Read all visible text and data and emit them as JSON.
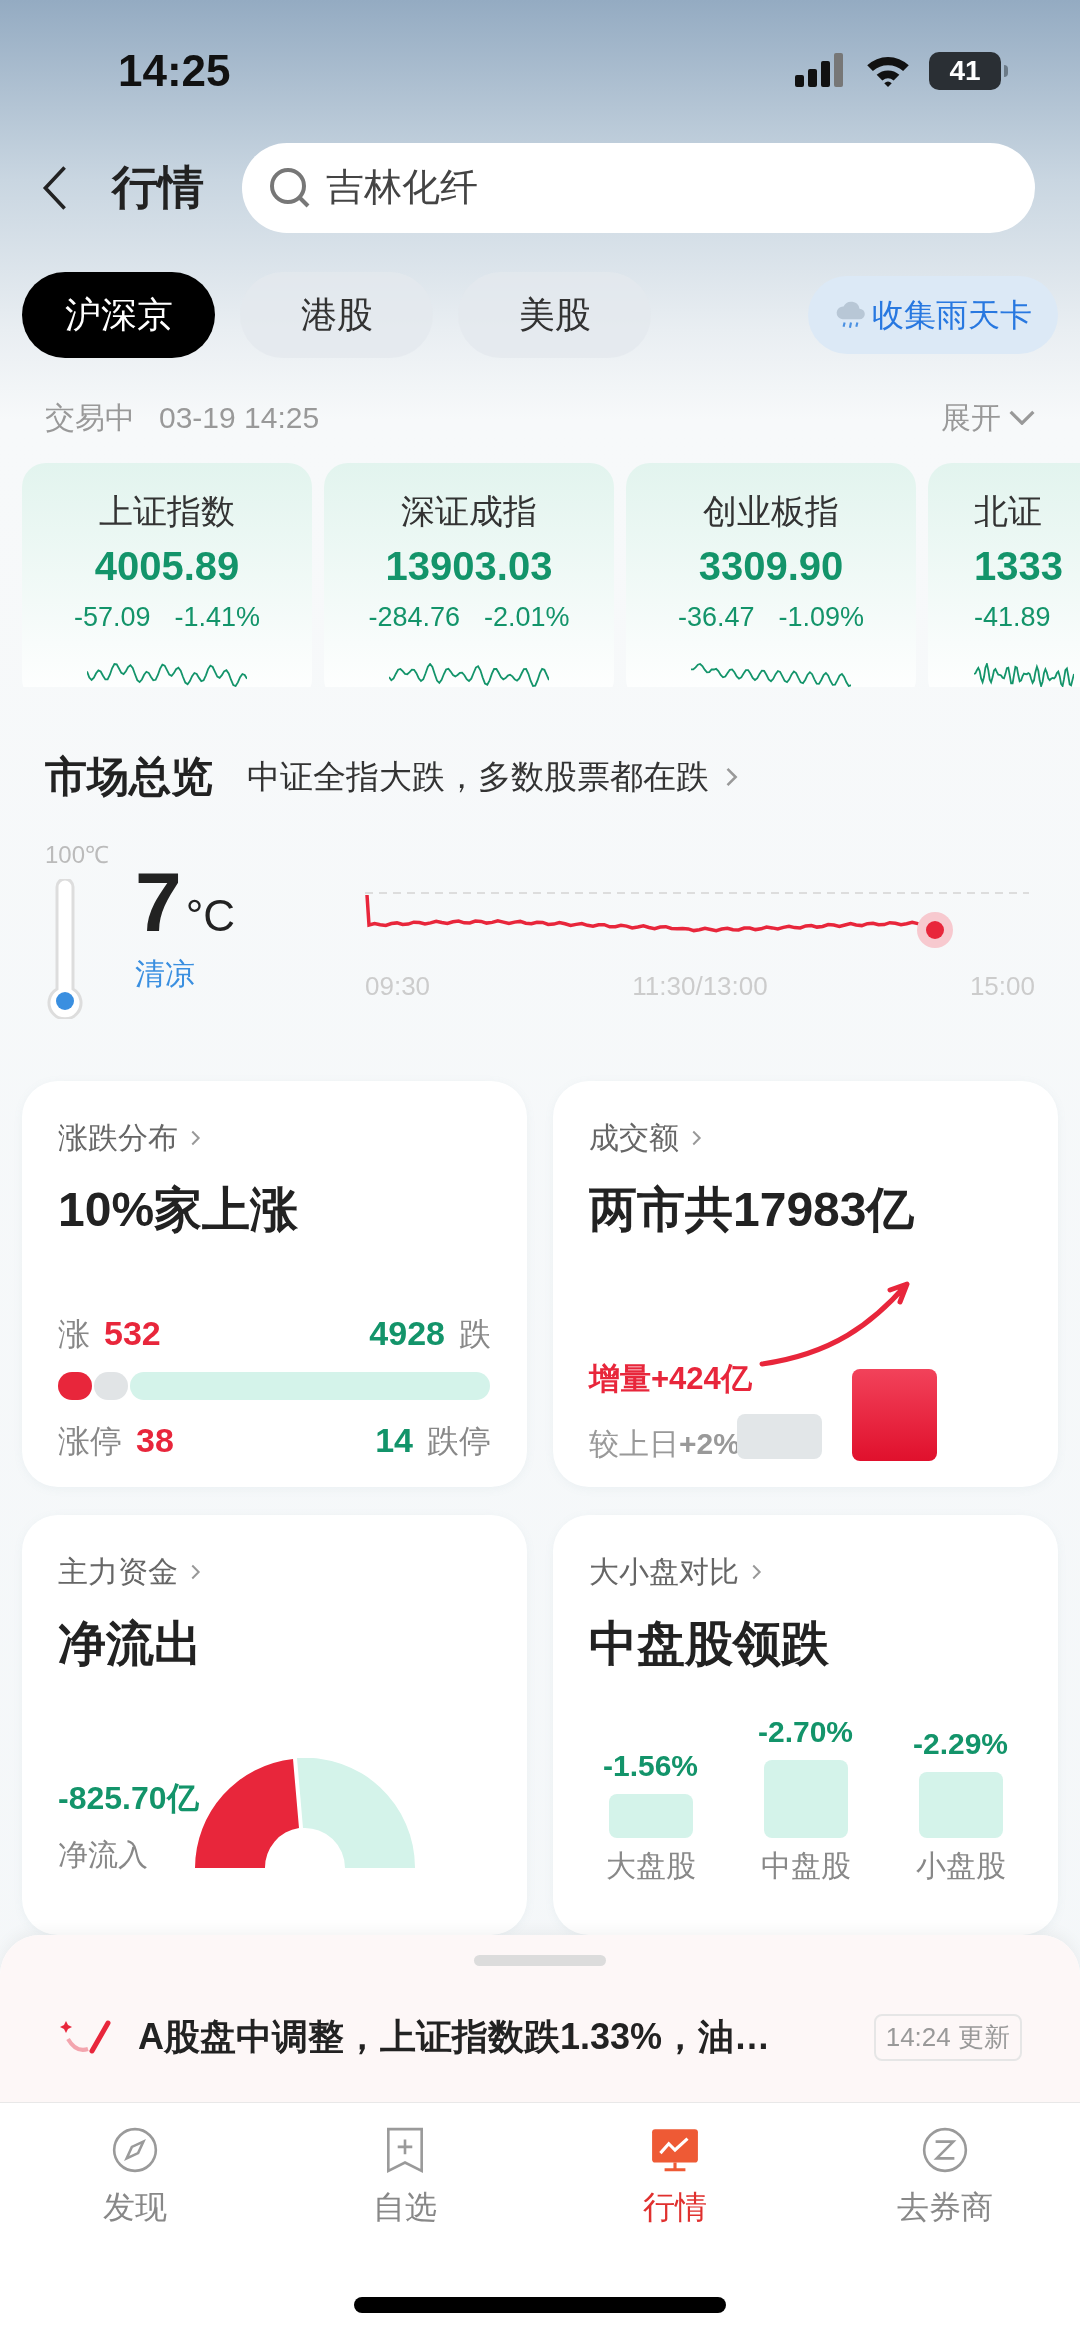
{
  "status_bar": {
    "time": "14:25",
    "battery": "41"
  },
  "header": {
    "title": "行情",
    "search": {
      "placeholder": "吉林化纤"
    }
  },
  "market_tabs": [
    {
      "label": "沪深京",
      "selected": true
    },
    {
      "label": "港股",
      "selected": false
    },
    {
      "label": "美股",
      "selected": false
    }
  ],
  "promo_button": {
    "label": "收集雨天卡"
  },
  "session": {
    "status": "交易中",
    "time": "03-19 14:25",
    "expand": "展开"
  },
  "indices": [
    {
      "name": "上证指数",
      "value": "4005.89",
      "change": "-57.09",
      "percent": "-1.41%"
    },
    {
      "name": "深证成指",
      "value": "13903.03",
      "change": "-284.76",
      "percent": "-2.01%"
    },
    {
      "name": "创业板指",
      "value": "3309.90",
      "change": "-36.47",
      "percent": "-1.09%"
    },
    {
      "name": "北证",
      "value": "1333",
      "change": "-41.89"
    }
  ],
  "market_overview": {
    "title": "市场总览",
    "summary": "中证全指大跌，多数股票都在跌",
    "scale_max": "100℃",
    "temperature": "7",
    "unit": "°C",
    "mood": "清凉",
    "time_labels": [
      "09:30",
      "11:30/13:00",
      "15:00"
    ]
  },
  "breadth": {
    "title": "涨跌分布",
    "headline": "10%家上涨",
    "up_label": "涨",
    "up_count": "532",
    "down_count": "4928",
    "down_label": "跌",
    "limit_up_label": "涨停",
    "limit_up_count": "38",
    "limit_down_count": "14",
    "limit_down_label": "跌停"
  },
  "turnover": {
    "title": "成交额",
    "headline": "两市共17983亿",
    "increase": "增量+424亿",
    "vs_prev": "较上日**+2%**"
  },
  "capital_flow": {
    "title": "主力资金",
    "headline": "净流出",
    "amount": "-825.70亿",
    "amount_label": "净流入"
  },
  "size_compare": {
    "title": "大小盘对比",
    "headline": "中盘股领跌",
    "groups": [
      {
        "name": "大盘股",
        "change": "-1.56%"
      },
      {
        "name": "中盘股",
        "change": "-2.70%"
      },
      {
        "name": "小盘股",
        "change": "-2.29%"
      }
    ]
  },
  "news": {
    "text": "A股盘中调整，上证指数跌1.33%，油…",
    "updated": "14:24 更新"
  },
  "bottom_nav": [
    {
      "label": "发现",
      "selected": false
    },
    {
      "label": "自选",
      "selected": false
    },
    {
      "label": "行情",
      "selected": true
    },
    {
      "label": "去券商",
      "selected": false
    }
  ]
}
